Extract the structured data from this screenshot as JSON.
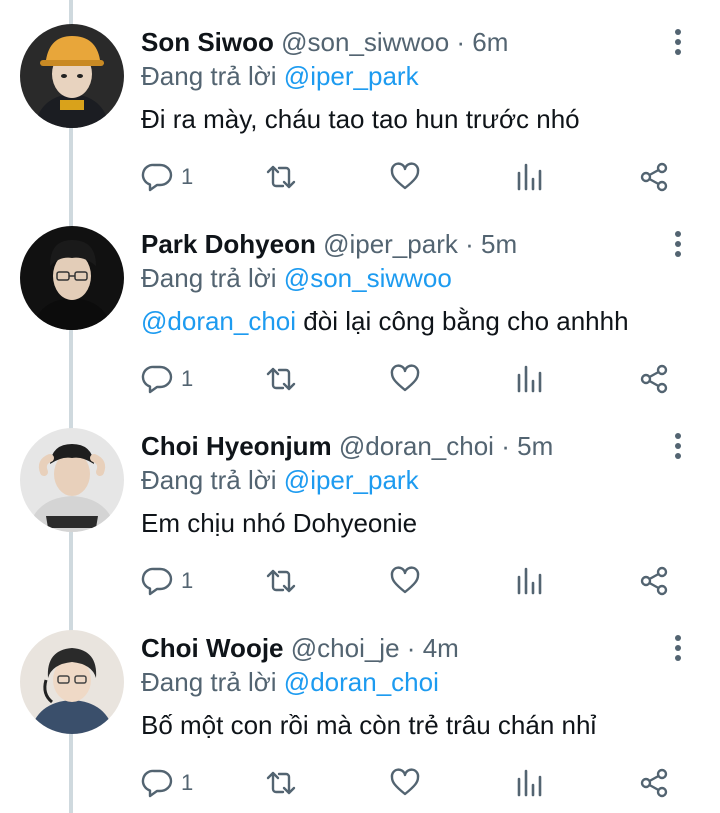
{
  "colors": {
    "link": "#1d9bf0",
    "muted": "#536471",
    "text": "#0f1419",
    "thread": "#cfd9de"
  },
  "icons": {
    "reply": "speech-bubble-icon",
    "retweet": "retweet-arrows-icon",
    "like": "heart-icon",
    "stats": "bar-chart-icon",
    "share": "share-icon",
    "more": "vertical-dots-icon"
  },
  "tweets": [
    {
      "name": "Son Siwoo",
      "handle": "@son_siwwoo",
      "sep": "·",
      "time": "6m",
      "reply_prefix": "Đang trả lời",
      "reply_to": "@iper_park",
      "text_mention": "",
      "text": "Đi ra mày, cháu tao tao hun trước nhó",
      "reply_count": "1"
    },
    {
      "name": "Park Dohyeon",
      "handle": "@iper_park",
      "sep": "·",
      "time": "5m",
      "reply_prefix": "Đang trả lời",
      "reply_to": "@son_siwwoo",
      "text_mention": "@doran_choi",
      "text": " đòi lại công bằng cho anhhh",
      "reply_count": "1"
    },
    {
      "name": "Choi Hyeonjum",
      "handle": "@doran_choi",
      "sep": "·",
      "time": "5m",
      "reply_prefix": "Đang trả lời",
      "reply_to": "@iper_park",
      "text_mention": "",
      "text": "Em chịu nhó Dohyeonie",
      "reply_count": "1"
    },
    {
      "name": "Choi Wooje",
      "handle": "@choi_je",
      "sep": "·",
      "time": "4m",
      "reply_prefix": "Đang trả lời",
      "reply_to": "@doran_choi",
      "text_mention": "",
      "text": "Bố một con rồi mà còn trẻ trâu chán nhỉ",
      "reply_count": "1"
    }
  ]
}
